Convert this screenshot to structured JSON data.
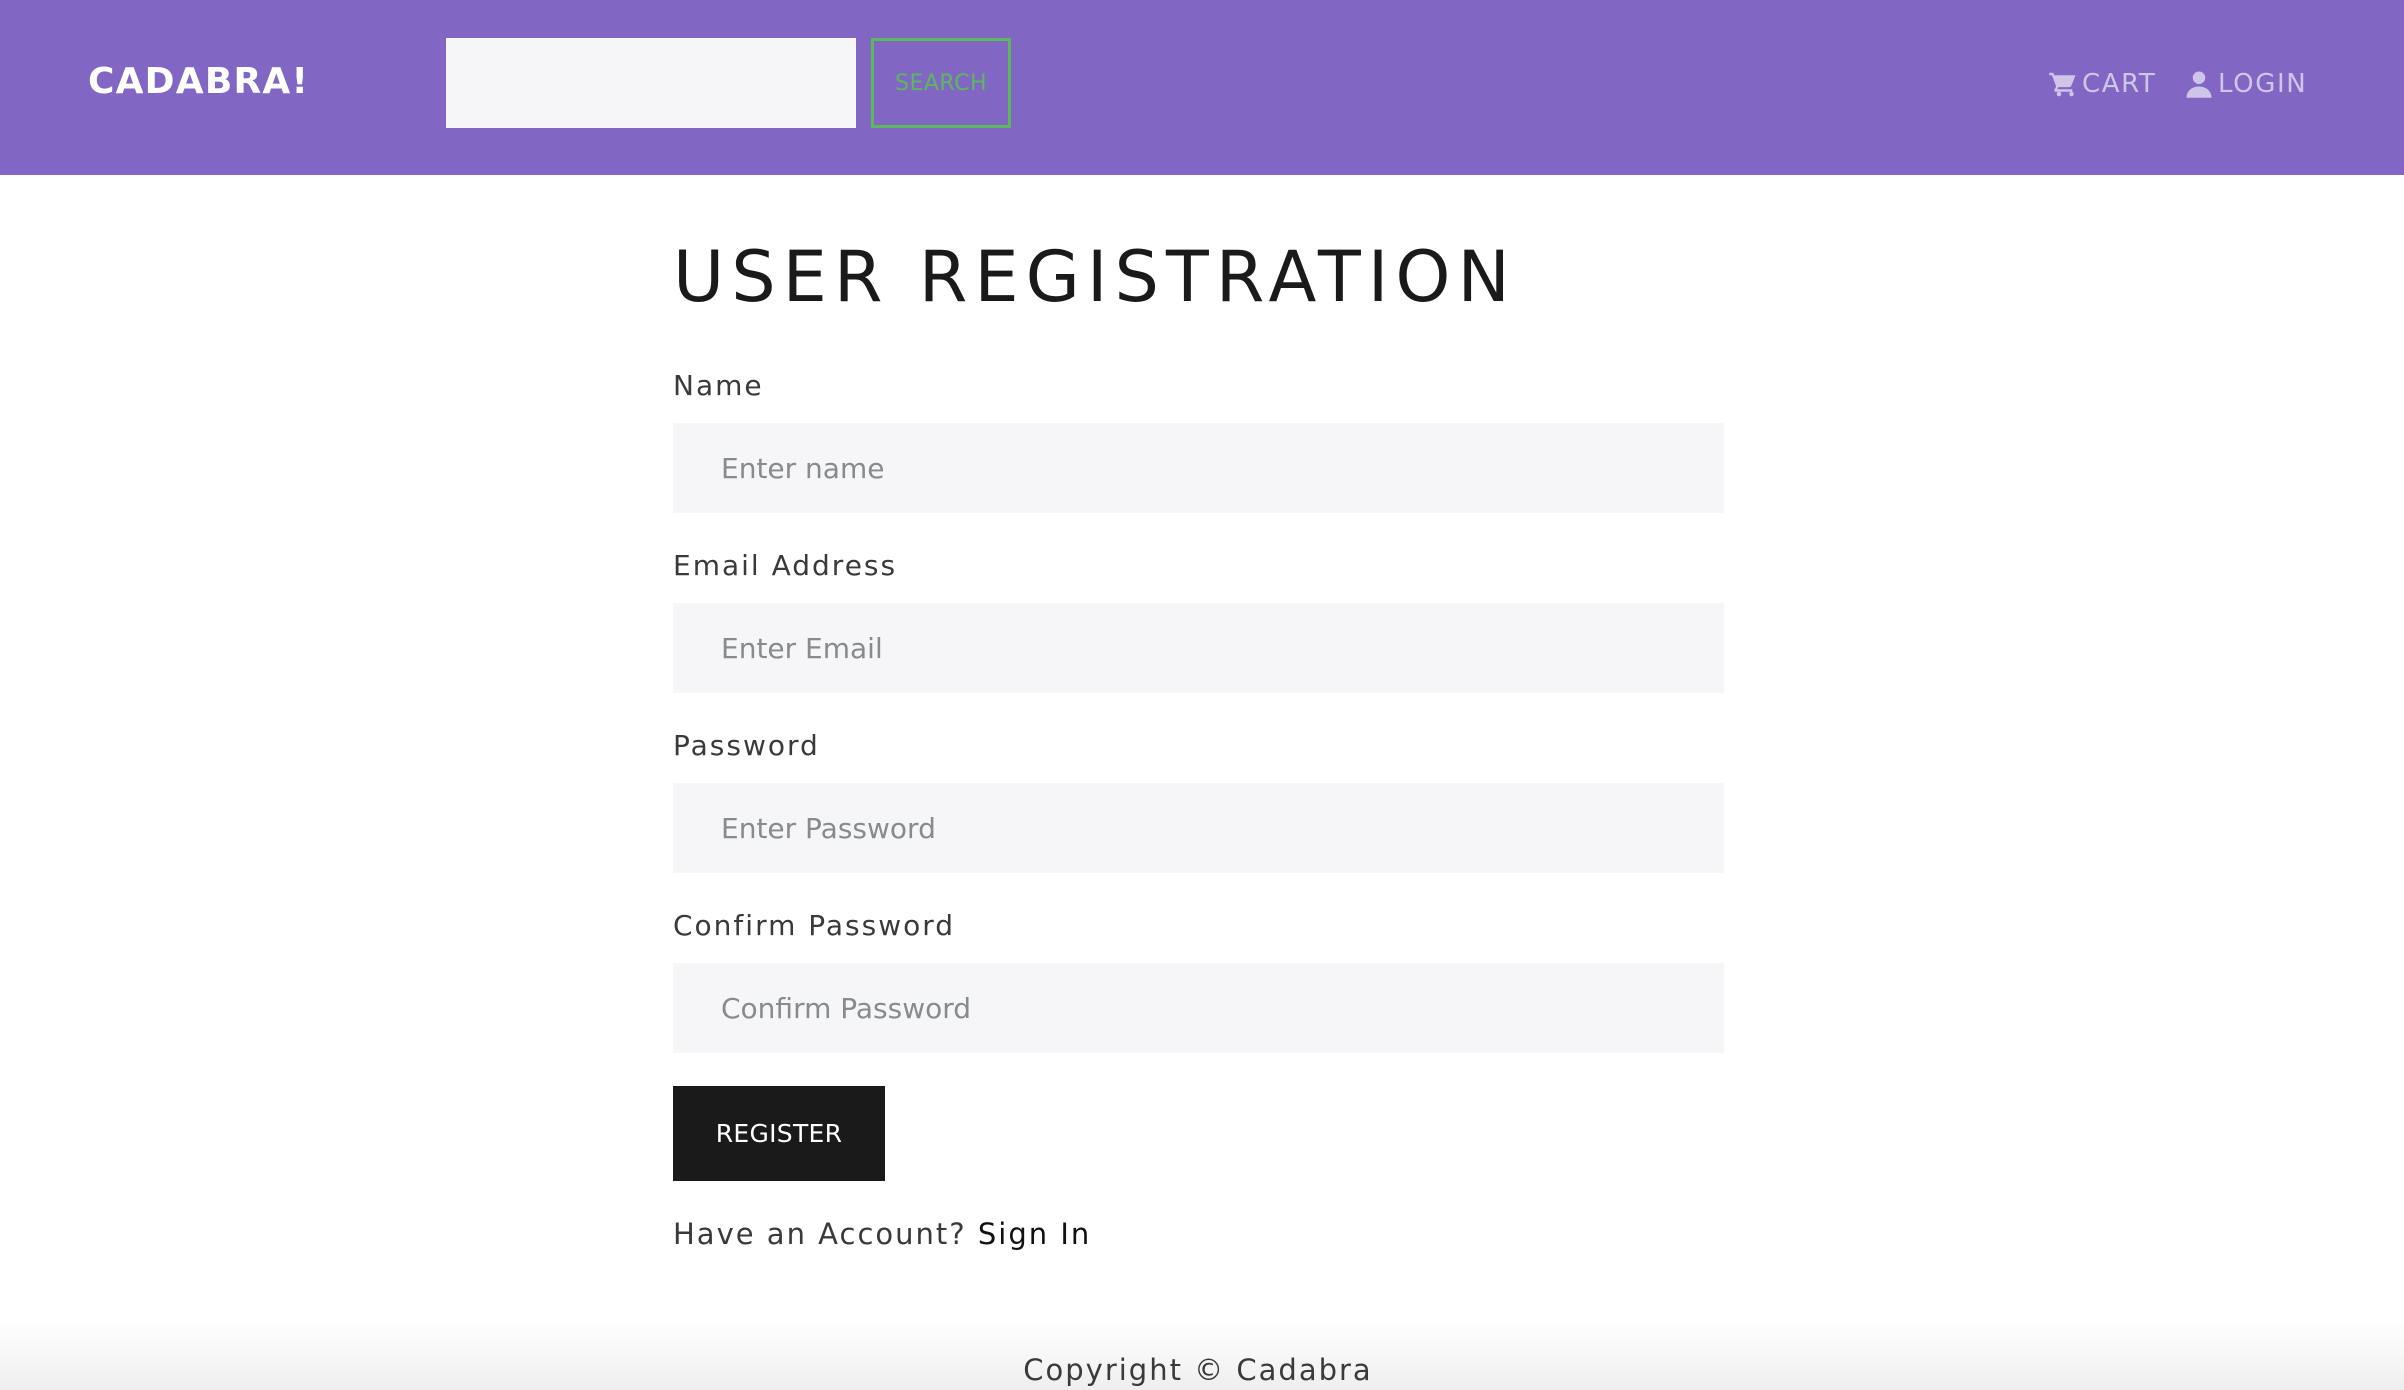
{
  "header": {
    "brand": "CADABRA!",
    "search": {
      "placeholder": "",
      "button_label": "SEARCH"
    },
    "nav": {
      "cart_label": "CART",
      "cart_icon": "cart-icon",
      "login_label": "LOGIN",
      "login_icon": "user-icon"
    }
  },
  "form": {
    "title": "USER REGISTRATION",
    "fields": {
      "name": {
        "label": "Name",
        "placeholder": "Enter name",
        "value": ""
      },
      "email": {
        "label": "Email Address",
        "placeholder": "Enter Email",
        "value": ""
      },
      "password": {
        "label": "Password",
        "placeholder": "Enter Password",
        "value": ""
      },
      "confirm_password": {
        "label": "Confirm Password",
        "placeholder": "Confirm Password",
        "value": ""
      }
    },
    "submit_label": "REGISTER",
    "have_account_text": "Have an Account?",
    "signin_label": "Sign In"
  },
  "footer": {
    "copyright": "Copyright © Cadabra"
  },
  "colors": {
    "header_bg": "#8166c3",
    "search_accent": "#5cb85c",
    "button_bg": "#1a1a1a",
    "input_bg": "#f6f6f8"
  }
}
